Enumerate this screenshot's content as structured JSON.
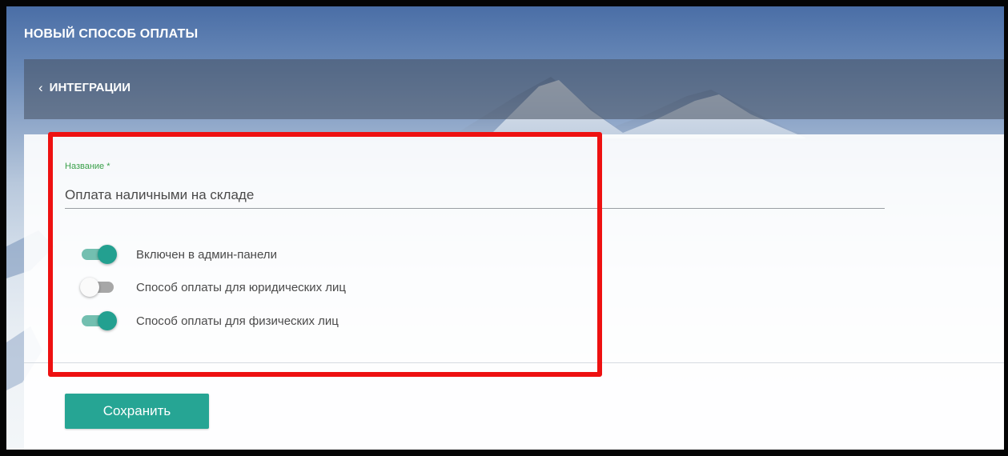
{
  "header": {
    "title": "НОВЫЙ СПОСОБ ОПЛАТЫ"
  },
  "breadcrumb": {
    "back_icon": "chevron-left-icon",
    "label": "ИНТЕГРАЦИИ"
  },
  "form": {
    "name_field": {
      "label": "Название *",
      "value": "Оплата наличными на складе"
    },
    "toggles": [
      {
        "label": "Включен в админ-панели",
        "checked": true
      },
      {
        "label": "Способ оплаты для юридических лиц",
        "checked": false
      },
      {
        "label": "Способ оплаты для физических лиц",
        "checked": true
      }
    ],
    "save_label": "Сохранить"
  },
  "colors": {
    "accent": "#26a594",
    "label_green": "#3aa04a",
    "highlight": "#ee1111"
  }
}
